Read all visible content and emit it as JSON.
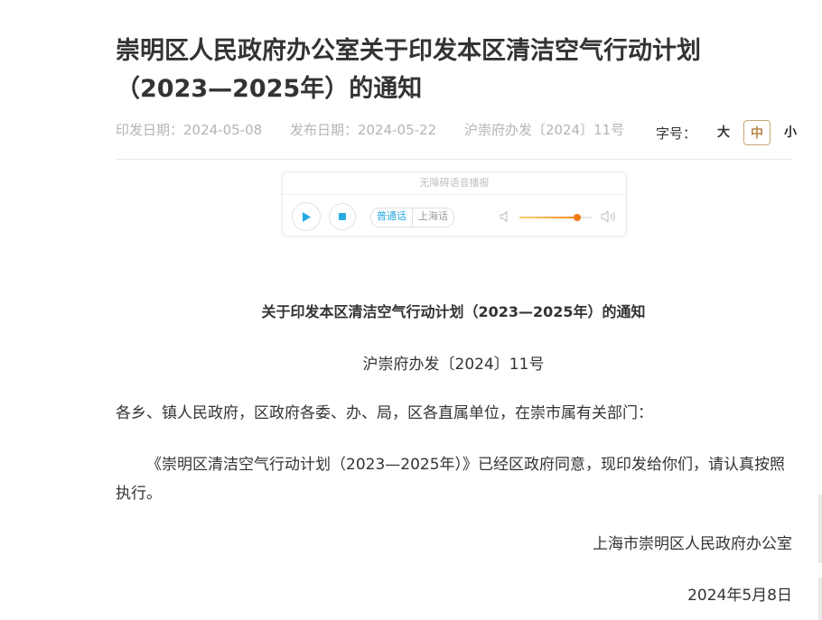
{
  "article": {
    "title": "崇明区人民政府办公室关于印发本区清洁空气行动计划（2023—2025年）的通知",
    "print_date": "印发日期：2024-05-08",
    "publish_date": "发布日期：2024-05-22",
    "doc_number": "沪崇府办发〔2024〕11号"
  },
  "font_size": {
    "label": "字号：",
    "large": "大",
    "medium": "中",
    "small": "小",
    "selected": "中"
  },
  "player": {
    "header": "无障碍语音播报",
    "play_icon": "play-icon",
    "stop_icon": "stop-icon",
    "lang_mandarin": "普通话",
    "lang_shanghai": "上海话",
    "selected_lang": "普通话",
    "volume": 0.8,
    "accent_color": "#27a9e1",
    "volume_color": "#f07a12"
  },
  "body": {
    "doc_title": "关于印发本区清洁空气行动计划（2023—2025年）的通知",
    "doc_number": "沪崇府办发〔2024〕11号",
    "recipients": "各乡、镇人民政府，区政府各委、办、局，区各直属单位，在崇市属有关部门：",
    "content": "《崇明区清洁空气行动计划（2023—2025年）》已经区政府同意，现印发给你们，请认真按照执行。",
    "signature": "上海市崇明区人民政府办公室",
    "date": "2024年5月8日"
  }
}
